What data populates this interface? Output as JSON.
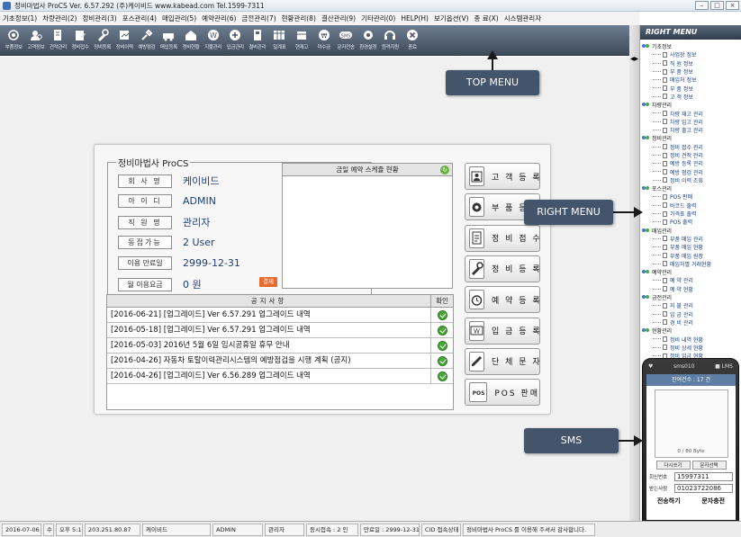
{
  "title_bar": {
    "text": "정비마법사 ProCS  Ver. 6.57.292  (주)케이비드  www.kabead.com  Tel.1599-7311",
    "controls": [
      "–",
      "□",
      "×"
    ]
  },
  "menu_bar": [
    "기초정보(1)",
    "차량관리(2)",
    "정비관리(3)",
    "포스관리(4)",
    "매입관리(5)",
    "예약관리(6)",
    "금전관리(7)",
    "현황관리(8)",
    "결산관리(9)",
    "기타관리(0)",
    "HELP(H)",
    "보기옵션(V)",
    "종 료(X)",
    "시스템관리자"
  ],
  "toolbar": [
    {
      "label": "부품정보",
      "icon": "parts-info-icon"
    },
    {
      "label": "고객정보",
      "icon": "customer-info-icon"
    },
    {
      "label": "견적관리",
      "icon": "estimate-icon"
    },
    {
      "label": "정비접수",
      "icon": "repair-receipt-icon"
    },
    {
      "label": "정비등록",
      "icon": "repair-register-icon"
    },
    {
      "label": "정비이력",
      "icon": "repair-history-icon"
    },
    {
      "label": "예방점검",
      "icon": "preventive-check-icon"
    },
    {
      "label": "매입등록",
      "icon": "purchase-register-icon"
    },
    {
      "label": "정비현황",
      "icon": "repair-status-icon"
    },
    {
      "label": "지불관리",
      "icon": "payment-icon"
    },
    {
      "label": "입금관리",
      "icon": "deposit-icon"
    },
    {
      "label": "결비관리",
      "icon": "expense-icon"
    },
    {
      "label": "일계표",
      "icon": "daily-report-icon"
    },
    {
      "label": "현재고",
      "icon": "stock-icon"
    },
    {
      "label": "미수금",
      "icon": "receivable-icon"
    },
    {
      "label": "문자전송",
      "icon": "sms-icon"
    },
    {
      "label": "환경설정",
      "icon": "settings-icon"
    },
    {
      "label": "원격지원",
      "icon": "remote-support-icon"
    },
    {
      "label": "종료",
      "icon": "exit-icon"
    }
  ],
  "right_menu": {
    "title": "RIGHT MENU",
    "side_tab": "RIGHT MENU",
    "groups": [
      {
        "name": "기초정보",
        "items": [
          "사업장 정보",
          "직 원 정보",
          "부 품 정보",
          "매입처 정보",
          "부 품 정보",
          "고 객 정보"
        ]
      },
      {
        "name": "차량관리",
        "items": [
          "차량 재고 관리",
          "차량 입고 관리",
          "차량 출고 관리"
        ]
      },
      {
        "name": "정비관리",
        "items": [
          "정비 접수 관리",
          "정비 견적 관리",
          "예방 등록 관리",
          "예방 점검 관리",
          "정비 이력 조회"
        ]
      },
      {
        "name": "포스관리",
        "items": [
          "POS 판매",
          "바코드 출력",
          "가격표 출력",
          "POS 출력"
        ]
      },
      {
        "name": "매입관리",
        "items": [
          "부품 매입 관리",
          "부품 매입 현황",
          "부품 매입 원장",
          "매입처별 거래현황"
        ]
      },
      {
        "name": "예약관리",
        "items": [
          "예 약 관리",
          "예 약 현황"
        ]
      },
      {
        "name": "금전관리",
        "items": [
          "지 불 관리",
          "입 금 관리",
          "경 비 관리"
        ]
      },
      {
        "name": "현황관리",
        "items": [
          "정비 내역 현황",
          "정비 상세 현황",
          "정비 입금 현황",
          "정비 미수금 현황"
        ]
      }
    ]
  },
  "splitter": {
    "arrows": "◀▶"
  },
  "dashboard": {
    "brand": "정비마법사 ProCS",
    "info": [
      {
        "label": "회 사 명",
        "value": "케이비드"
      },
      {
        "label": "아 이 디",
        "value": "ADMIN"
      },
      {
        "label": "직 원 명",
        "value": "관리자"
      },
      {
        "label": "동접가능",
        "value": "2 User"
      },
      {
        "label": "이용 만료일",
        "value": "2999-12-31"
      },
      {
        "label": "월 이용요금",
        "value": "0 원"
      }
    ],
    "pay_button": "결제",
    "schedule_title": "금일 예약 스케쥴 현황",
    "schedule_refresh_icon": "refresh-icon",
    "notice_header": "공지사항",
    "notice_check_header": "확인",
    "notices": [
      "[2016-06-21] [업그레이드] Ver 6.57.291 업그레이드 내역",
      "[2016-05-18] [업그레이드] Ver 6.57.291 업그레이드 내역",
      "[2016-05-03] 2016년 5월 6일 임시공휴일 휴무 안내",
      "[2016-04-26] 자동차 토탈이력관리시스템의 예방점검을 시행 계획 (공지)",
      "[2016-04-26] [업그레이드] Ver 6.56.289 업그레이드 내역"
    ],
    "quick_buttons": [
      {
        "label": "고 객 등 록",
        "icon": "customer-register-icon"
      },
      {
        "label": "부 품 등 록",
        "icon": "parts-register-icon"
      },
      {
        "label": "정 비 접 수",
        "icon": "repair-receipt-icon"
      },
      {
        "label": "정 비 등 록",
        "icon": "repair-register-icon"
      },
      {
        "label": "예 약 등 록",
        "icon": "reservation-icon"
      },
      {
        "label": "입 금 등 록",
        "icon": "deposit-register-icon"
      },
      {
        "label": "단 체 문 자",
        "icon": "group-sms-icon"
      },
      {
        "label": "POS 판매",
        "icon": "pos-sale-icon"
      }
    ]
  },
  "callouts": {
    "top": "TOP MENU",
    "right": "RIGHT MENU",
    "sms": "SMS"
  },
  "sms_phone": {
    "carrier": "sms010",
    "mode": "LMS",
    "count_label": "잔여건수 : 17 건",
    "byte_count": "0 / 80 Byte",
    "btn_rewrite": "다시쓰기",
    "btn_select": "문자선택",
    "recv_label": "회신번호",
    "recv_value": "15997311",
    "send_label": "받는사람",
    "send_value": "01023722086",
    "action_send": "전송하기",
    "action_charge": "문자충전"
  },
  "status_bar": [
    "2016-07-06",
    "수",
    "오후 5:16",
    "203.251.80.87",
    "케이비드",
    "ADMIN",
    "관리자",
    "동시접속 : 2 인",
    "만료일 : 2999-12-31",
    "CID 접속상태",
    "정비마법사 ProCS 를 이용해 주셔서 감사합니다."
  ],
  "colors": {
    "toolbar_bg": "#4f5d6e",
    "callout_bg": "#44546a",
    "link_blue": "#1f3f7a",
    "pay_orange": "#e86a2c",
    "check_green": "#4ba63a"
  }
}
